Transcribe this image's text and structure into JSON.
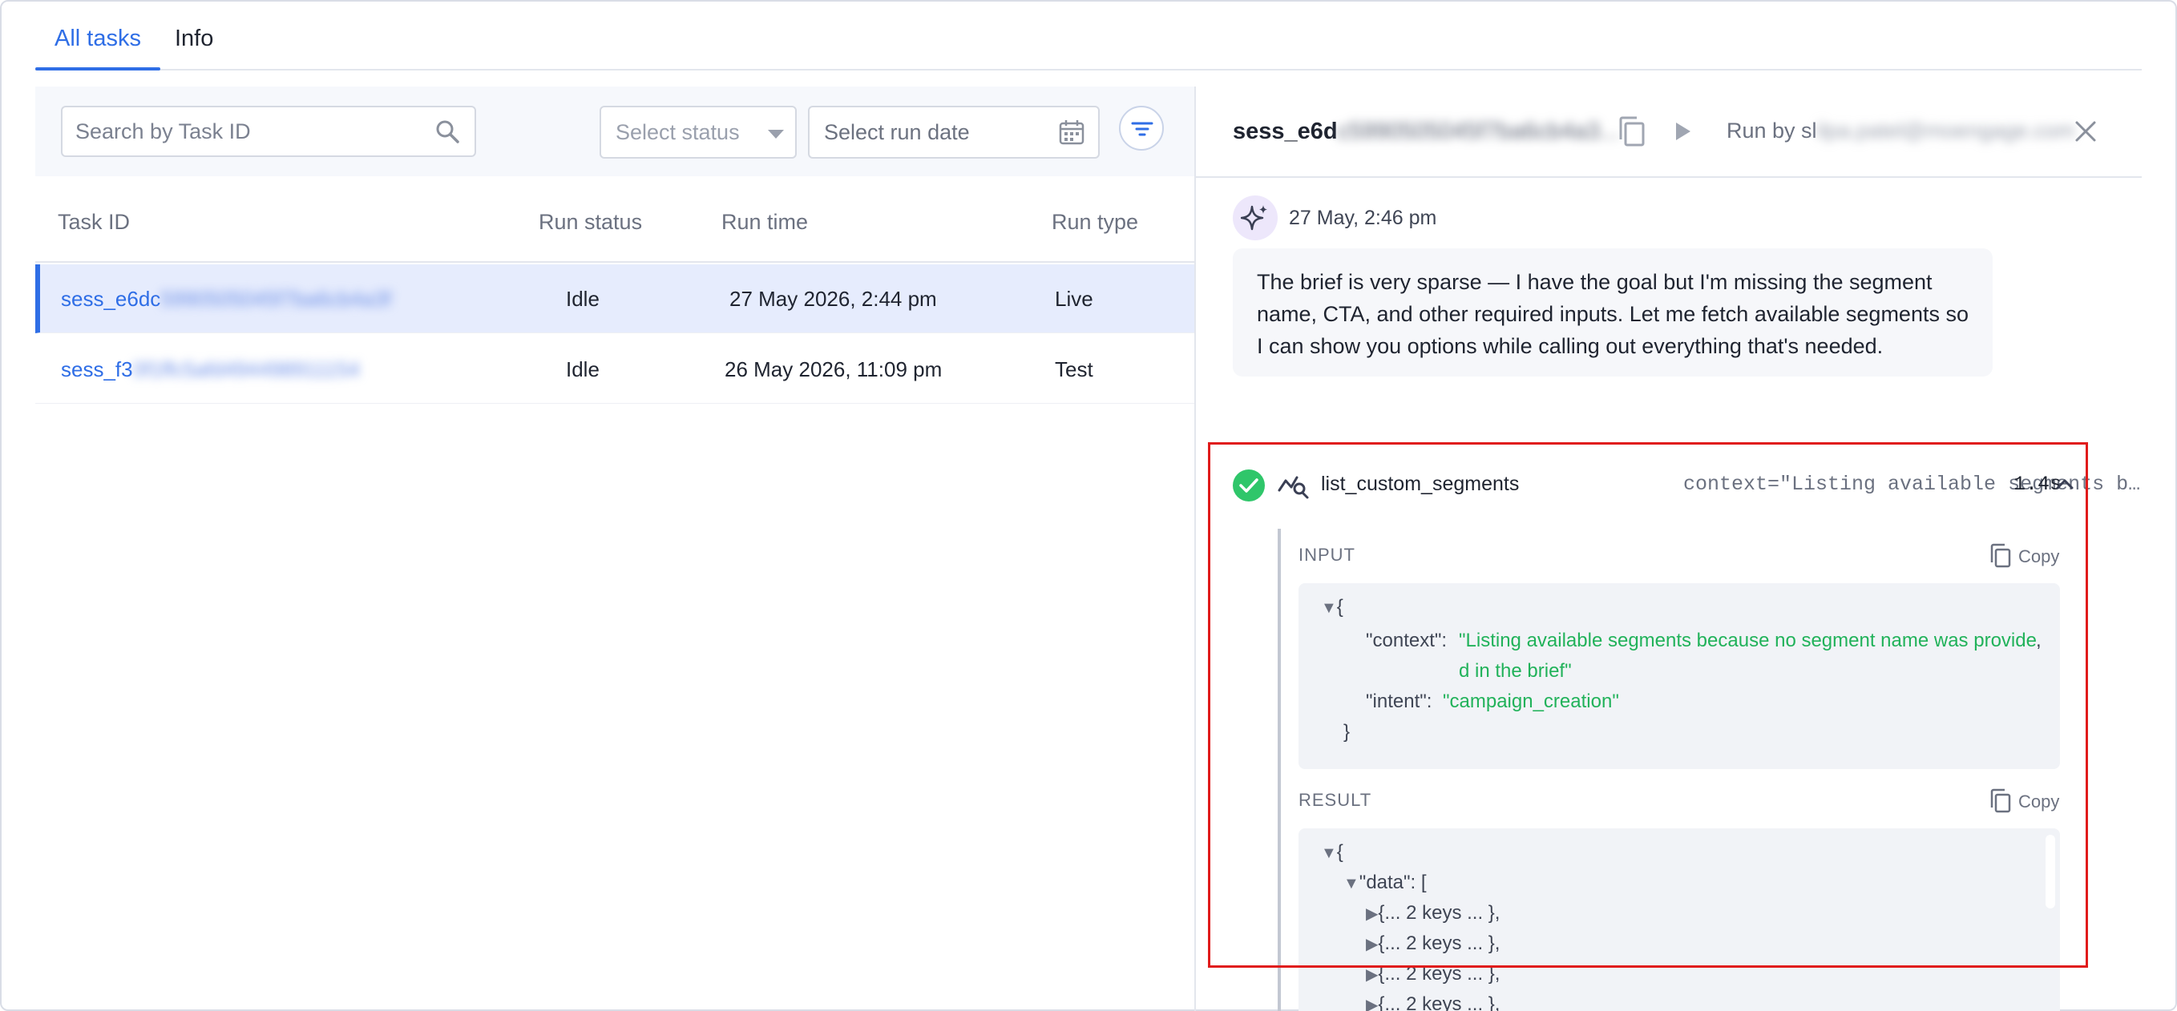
{
  "tabs": [
    {
      "label": "All tasks",
      "active": true
    },
    {
      "label": "Info",
      "active": false
    }
  ],
  "filters": {
    "search_placeholder": "Search by Task ID",
    "status_placeholder": "Select status",
    "date_placeholder": "Select run date"
  },
  "table": {
    "columns": [
      "Task ID",
      "Run status",
      "Run time",
      "Run type"
    ],
    "rows": [
      {
        "id_visible": "sess_e6dc",
        "id_blurred": "5990505045f7ba6cb4a3f",
        "status": "Idle",
        "time": "27 May 2026, 2:44 pm",
        "type": "Live",
        "selected": true
      },
      {
        "id_visible": "sess_f3",
        "id_blurred": "0f1ffc5afd494498911154",
        "status": "Idle",
        "time": "26 May 2026, 11:09 pm",
        "type": "Test",
        "selected": false
      }
    ]
  },
  "detail": {
    "session_visible": "sess_e6d",
    "session_blurred": "c5990505045f7ba6cb4a3...",
    "session_suffix": "...",
    "run_by_prefix": "Run by sl",
    "run_by_blurred": "ilpa.patel@moengage.com",
    "message": {
      "time": "27 May, 2:46 pm",
      "text": "The brief is very sparse — I have the goal but I'm missing the segment name, CTA, and other required inputs. Let me fetch available segments so I can show you options while calling out everything that's needed."
    },
    "tool_call": {
      "name": "list_custom_segments",
      "context_preview": "context=\"Listing available segments be…",
      "duration": "1.4s",
      "status": "success",
      "input_label": "INPUT",
      "result_label": "RESULT",
      "copy_label": "Copy",
      "input": {
        "open_brace": "{",
        "close_brace": "}",
        "context_key": "\"context\":",
        "context_line1": "\"Listing available segments because no segment name was provide",
        "context_line2": "d in the brief\"",
        "intent_key": "\"intent\":",
        "intent_value": "\"campaign_creation\"",
        "comma": ","
      },
      "result": {
        "open_brace": "{",
        "data_key": "\"data\":",
        "data_open": "[",
        "collapsed_item": "{... 2 keys ... },"
      }
    }
  },
  "colors": {
    "accent": "#2f6ee6",
    "success": "#2fc66a",
    "string": "#21b25a",
    "highlight": "#e01b1b"
  },
  "icons": {
    "search": "search-icon",
    "calendar": "calendar-icon",
    "filter": "filter-icon",
    "copy": "copy-icon",
    "play": "play-icon",
    "close": "close-icon",
    "sparkle": "sparkle-icon",
    "check": "check-icon",
    "tool": "chart-search-icon",
    "chevron": "chevron-up-icon"
  }
}
